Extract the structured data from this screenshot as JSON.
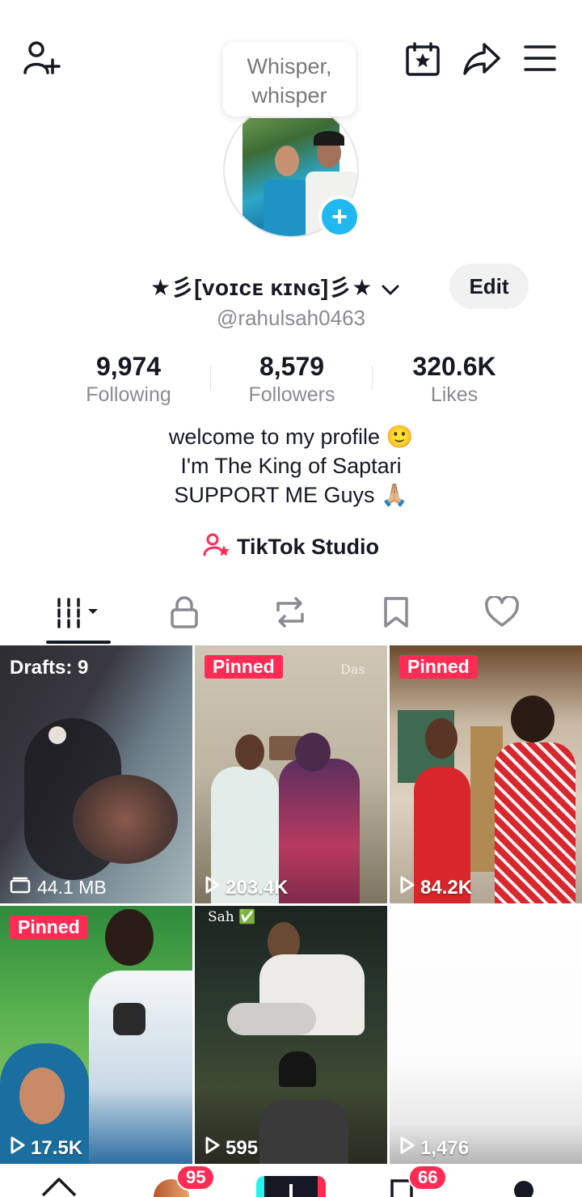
{
  "bubble": {
    "line1": "Whisper,",
    "line2": "whisper"
  },
  "profile": {
    "display_name": "★彡[ᴠᴏɪᴄᴇ ᴋɪɴɢ]彡★",
    "handle": "@rahulsah0463",
    "edit_label": "Edit"
  },
  "stats": [
    {
      "value": "9,974",
      "label": "Following"
    },
    {
      "value": "8,579",
      "label": "Followers"
    },
    {
      "value": "320.6K",
      "label": "Likes"
    }
  ],
  "bio": {
    "line1": "welcome to my profile 🙂",
    "line2": "I'm The King of Saptari",
    "line3": "SUPPORT ME Guys 🙏🏼"
  },
  "studio": {
    "label": "TikTok Studio"
  },
  "tabs": [
    "videos-grid",
    "private",
    "reposts",
    "favorites",
    "liked"
  ],
  "videos": [
    {
      "badge": "Drafts: 9",
      "meta": "44.1 MB"
    },
    {
      "badge": "Pinned",
      "watermark": "Das",
      "meta": "203.4K"
    },
    {
      "badge": "Pinned",
      "meta": "84.2K"
    },
    {
      "badge": "Pinned",
      "meta": "17.5K"
    },
    {
      "badge": "",
      "overlay": "Sah ✅",
      "meta": "595"
    },
    {
      "badge": "",
      "meta": "1,476"
    }
  ],
  "nav": {
    "inbox_badge": "95",
    "messages_badge": "66"
  },
  "colors": {
    "accent": "#fe2c55",
    "plus": "#20b8ee"
  }
}
